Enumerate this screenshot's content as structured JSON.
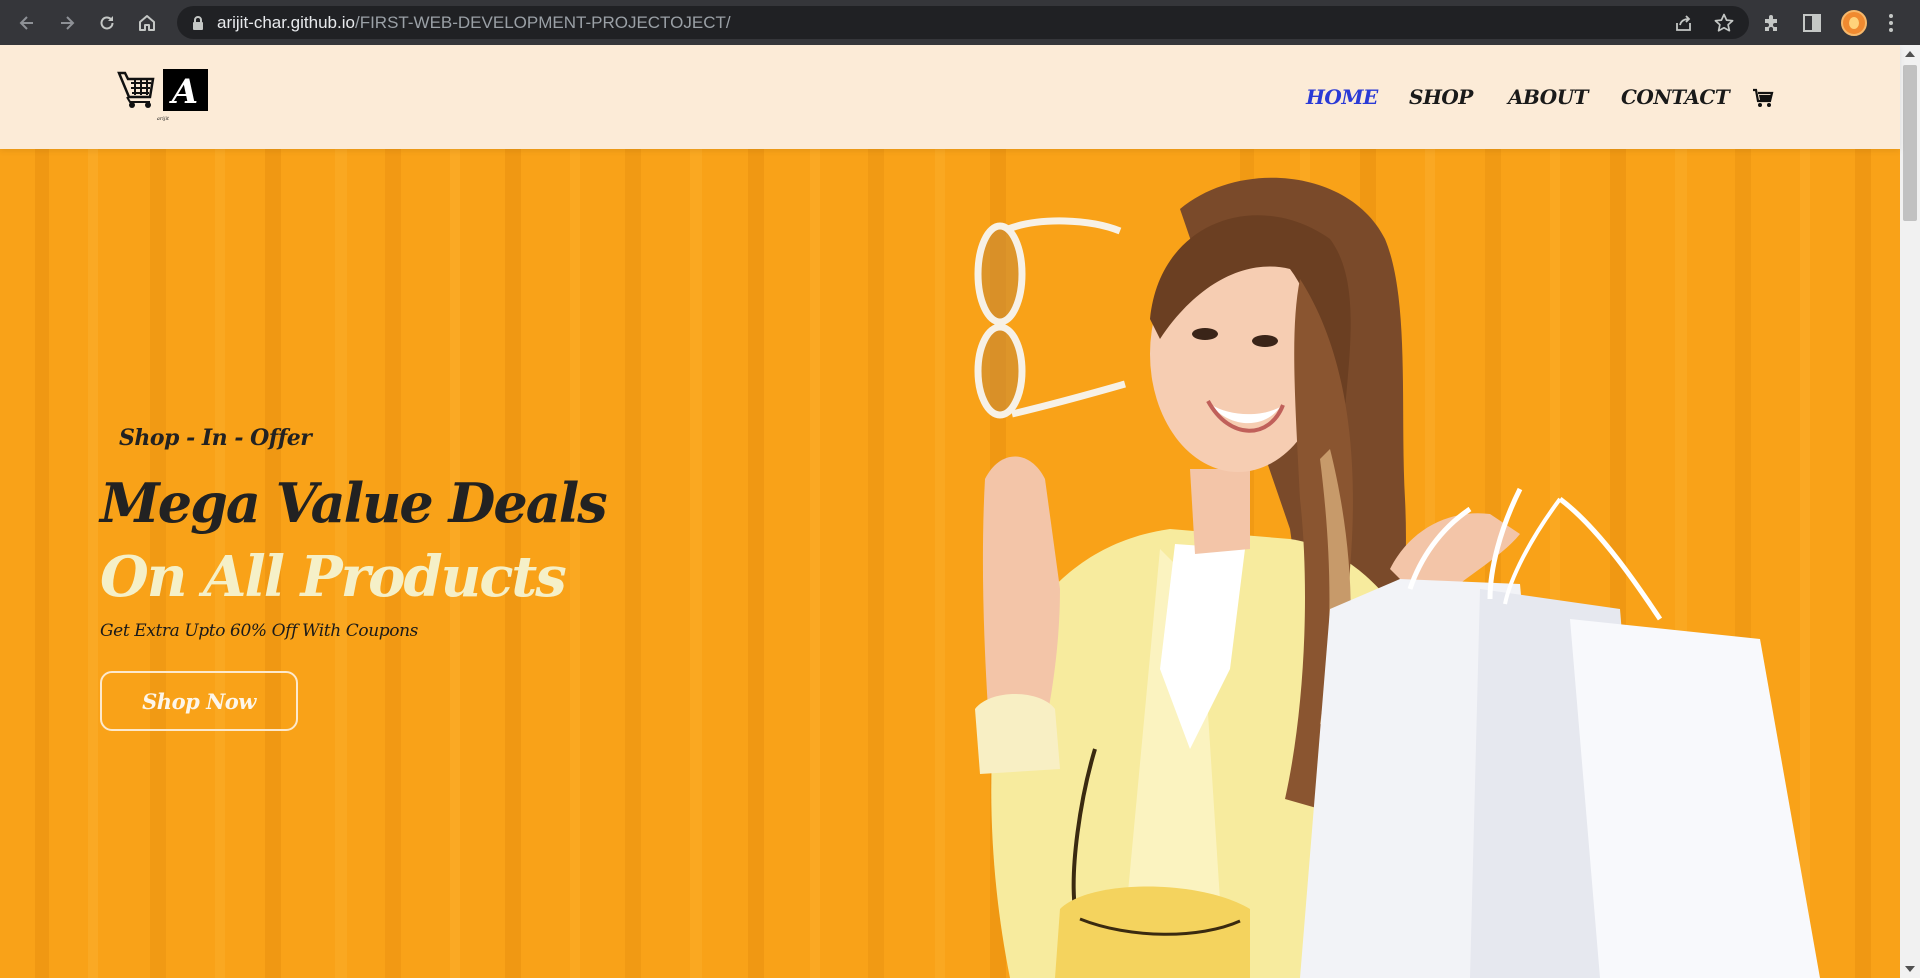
{
  "browser": {
    "url_host": "arijit-char.github.io",
    "url_path": "/FIRST-WEB-DEVELOPMENT-PROJECTOJECT/",
    "icons": [
      "back-arrow-icon",
      "forward-arrow-icon",
      "reload-icon",
      "home-icon",
      "lock-icon",
      "share-icon",
      "star-icon",
      "extensions-puzzle-icon",
      "side-panel-icon",
      "profile-avatar",
      "menu-dots-icon"
    ]
  },
  "header": {
    "logo_letter": "A",
    "logo_caption": "arijit",
    "nav": [
      {
        "label": "HOME",
        "active": true
      },
      {
        "label": "SHOP",
        "active": false
      },
      {
        "label": "ABOUT",
        "active": false
      },
      {
        "label": "CONTACT",
        "active": false
      }
    ],
    "cart_icon": "shopping-cart-icon"
  },
  "hero": {
    "tagline": "Shop - In - Offer",
    "headline_line1": "Mega Value Deals",
    "headline_line2": "On All Products",
    "subline": "Get Extra Upto 60% Off With Coupons",
    "button_label": "Shop Now"
  },
  "colors": {
    "header_bg": "#fcebd7",
    "hero_bg": "#f9a218",
    "active_nav": "#2a3ad6",
    "headline_accent": "#f5f0c8"
  }
}
